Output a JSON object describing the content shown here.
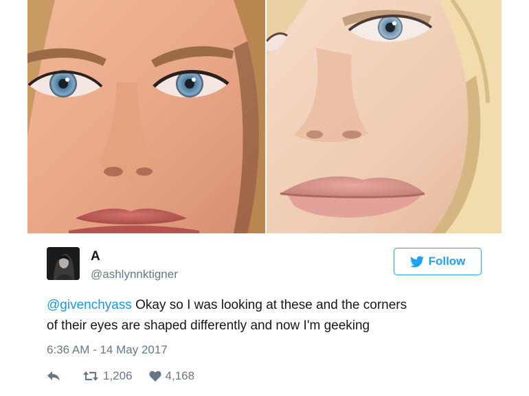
{
  "tweet": {
    "author": {
      "display_name": "A",
      "handle": "@ashlynnktigner"
    },
    "follow_label": "Follow",
    "text": {
      "mention": "@givenchyass",
      "line1_rest": " Okay so I was looking at these and the corners",
      "line2": "of their eyes are shaped differently and now I'm geeking"
    },
    "timestamp": "6:36 AM - 14 May 2017",
    "stats": {
      "retweets": "1,206",
      "likes": "4,168"
    }
  },
  "icons": {
    "follow": "twitter-bird-icon",
    "reply": "reply-arrow-icon",
    "retweet": "retweet-icon",
    "like": "heart-icon"
  },
  "colors": {
    "accent": "#1da1f2",
    "mention": "#1b95e0",
    "secondary_text": "#657786",
    "primary_text": "#14171a"
  }
}
